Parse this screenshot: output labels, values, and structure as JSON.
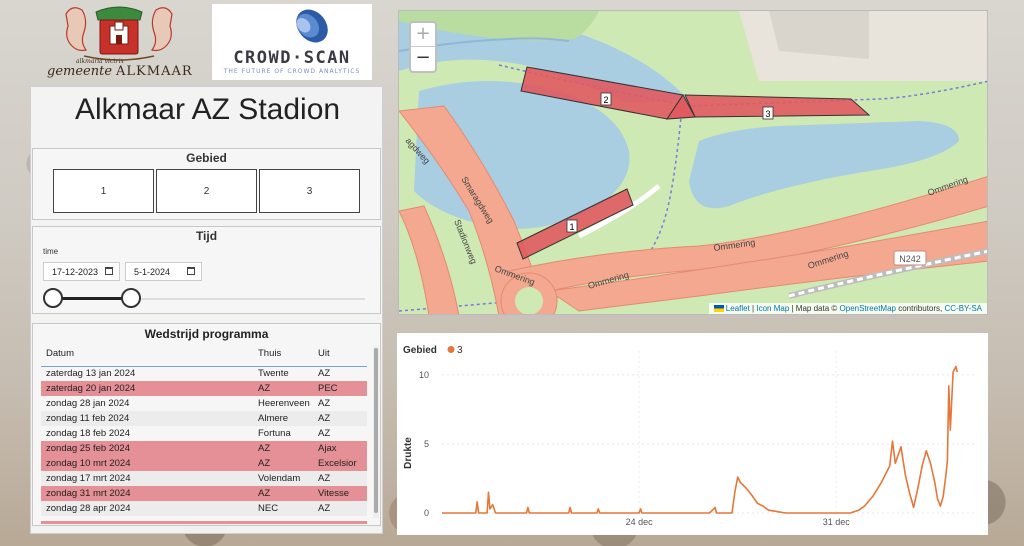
{
  "logos": {
    "municipality_motto": "alkmaria victrix",
    "municipality_prefix": "gemeente",
    "municipality_name": "ALKMAAR",
    "company_name": "CROWD·SCAN",
    "company_tagline": "THE FUTURE OF CROWD ANALYTICS"
  },
  "page_title": "Alkmaar AZ Stadion",
  "gebied": {
    "title": "Gebied",
    "buttons": [
      "1",
      "2",
      "3"
    ]
  },
  "tijd": {
    "title": "Tijd",
    "label": "time",
    "start_date": "17-12-2023",
    "end_date": "5-1-2024",
    "slider_start": 0,
    "slider_end": 0.3
  },
  "programma": {
    "title": "Wedstrijd programma",
    "columns": [
      "Datum",
      "Thuis",
      "Uit"
    ],
    "rows": [
      {
        "datum": "zaterdag 13 jan 2024",
        "thuis": "Twente",
        "uit": "AZ",
        "home": false
      },
      {
        "datum": "zaterdag 20 jan 2024",
        "thuis": "AZ",
        "uit": "PEC",
        "home": true
      },
      {
        "datum": "zondag 28 jan 2024",
        "thuis": "Heerenveen",
        "uit": "AZ",
        "home": false
      },
      {
        "datum": "zondag 11 feb 2024",
        "thuis": "Almere",
        "uit": "AZ",
        "home": false
      },
      {
        "datum": "zondag 18 feb 2024",
        "thuis": "Fortuna",
        "uit": "AZ",
        "home": false
      },
      {
        "datum": "zondag 25 feb 2024",
        "thuis": "AZ",
        "uit": "Ajax",
        "home": true
      },
      {
        "datum": "zondag 10 mrt 2024",
        "thuis": "AZ",
        "uit": "Excelsior",
        "home": true
      },
      {
        "datum": "zondag 17 mrt 2024",
        "thuis": "Volendam",
        "uit": "AZ",
        "home": false
      },
      {
        "datum": "zondag 31 mrt 2024",
        "thuis": "AZ",
        "uit": "Vitesse",
        "home": true
      },
      {
        "datum": "zondag 28 apr 2024",
        "thuis": "NEC",
        "uit": "AZ",
        "home": false
      }
    ]
  },
  "map": {
    "zoom_in": "+",
    "zoom_out": "−",
    "road_labels": [
      "Ommering",
      "Ommering",
      "Ommering",
      "Ommering",
      "Ommering",
      "Stadionweg",
      "Smaragdweg",
      "agdweg",
      "N242"
    ],
    "area_labels": [
      "1",
      "2",
      "3"
    ],
    "attribution": {
      "leaflet": "Leaflet",
      "iconmap": "Icon Map",
      "data": "Map data ©",
      "osm": "OpenStreetMap",
      "contributors": "contributors,",
      "license": "CC-BY-SA"
    }
  },
  "colors": {
    "highlight": "#e58f96",
    "series": "#e5773a",
    "zone_fill": "#e05a5f"
  },
  "chart_data": {
    "type": "line",
    "legend_title": "Gebied",
    "series": [
      {
        "name": "3",
        "color": "#e5773a"
      }
    ],
    "ylabel": "Drukte",
    "ylim": [
      0,
      11
    ],
    "yticks": [
      0,
      5,
      10
    ],
    "xticks": [
      "24 dec",
      "31 dec"
    ],
    "xrange_days": [
      17,
      36
    ],
    "values": [
      [
        17.0,
        0
      ],
      [
        18.2,
        0
      ],
      [
        18.25,
        0.8
      ],
      [
        18.3,
        0
      ],
      [
        18.6,
        0
      ],
      [
        18.65,
        1.5
      ],
      [
        18.7,
        0.3
      ],
      [
        18.8,
        0.6
      ],
      [
        18.9,
        0
      ],
      [
        20.0,
        0
      ],
      [
        20.05,
        0.4
      ],
      [
        20.1,
        0
      ],
      [
        21.5,
        0
      ],
      [
        21.55,
        0.4
      ],
      [
        21.6,
        0
      ],
      [
        22.5,
        0
      ],
      [
        22.55,
        0.3
      ],
      [
        22.6,
        0
      ],
      [
        24.0,
        0
      ],
      [
        24.05,
        0.3
      ],
      [
        24.1,
        0
      ],
      [
        26.5,
        0
      ],
      [
        26.7,
        0.4
      ],
      [
        26.75,
        0
      ],
      [
        27.3,
        0
      ],
      [
        27.4,
        1.5
      ],
      [
        27.5,
        2.6
      ],
      [
        27.6,
        2.2
      ],
      [
        27.8,
        1.8
      ],
      [
        28.0,
        1.3
      ],
      [
        28.2,
        0.7
      ],
      [
        28.4,
        0.5
      ],
      [
        28.6,
        0.2
      ],
      [
        28.9,
        0.1
      ],
      [
        29.2,
        0
      ],
      [
        31.0,
        0
      ],
      [
        31.5,
        0
      ],
      [
        31.8,
        0.2
      ],
      [
        32.0,
        0.5
      ],
      [
        32.3,
        1.2
      ],
      [
        32.6,
        2.2
      ],
      [
        32.9,
        3.4
      ],
      [
        33.0,
        5.2
      ],
      [
        33.1,
        3.6
      ],
      [
        33.3,
        4.8
      ],
      [
        33.45,
        2.8
      ],
      [
        33.6,
        1.5
      ],
      [
        33.75,
        0.4
      ],
      [
        33.9,
        1.8
      ],
      [
        34.05,
        3.4
      ],
      [
        34.2,
        4.5
      ],
      [
        34.35,
        3.6
      ],
      [
        34.5,
        2.2
      ],
      [
        34.6,
        1.0
      ],
      [
        34.7,
        0.5
      ],
      [
        34.8,
        1.2
      ],
      [
        34.9,
        2.8
      ],
      [
        34.95,
        3.8
      ],
      [
        35.0,
        9.2
      ],
      [
        35.05,
        6.0
      ],
      [
        35.15,
        10.2
      ],
      [
        35.25,
        10.6
      ],
      [
        35.3,
        10.2
      ]
    ]
  }
}
